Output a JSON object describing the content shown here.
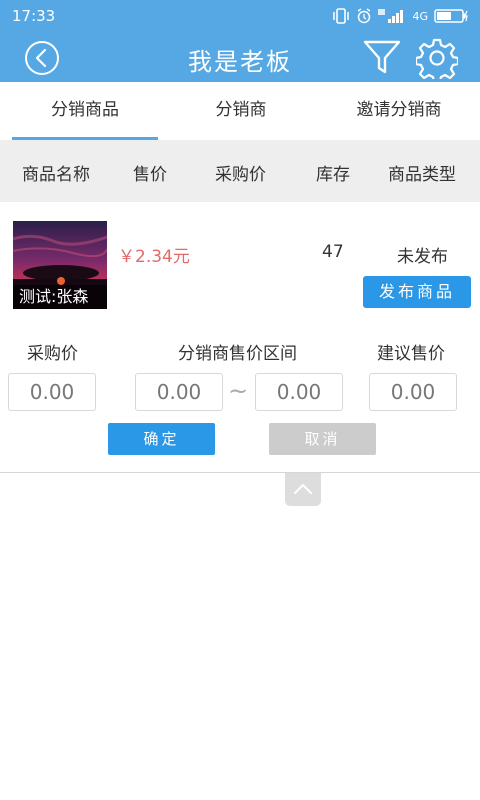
{
  "status_bar": {
    "time": "17:33",
    "network": "4G",
    "icons": [
      "vibrate-icon",
      "alarm-icon",
      "signal-icon",
      "battery-icon"
    ]
  },
  "app_bar": {
    "title": "我是老板",
    "icons": [
      "back-icon",
      "filter-icon",
      "settings-icon"
    ]
  },
  "tabs": [
    {
      "label": "分销商品",
      "active": true
    },
    {
      "label": "分销商",
      "active": false
    },
    {
      "label": "邀请分销商",
      "active": false
    }
  ],
  "columns": [
    "商品名称",
    "售价",
    "采购价",
    "库存",
    "商品类型"
  ],
  "product": {
    "caption": "测试:张森",
    "price": "￥2.34元",
    "stock": "47",
    "status": "未发布",
    "publish_label": "发布商品"
  },
  "pricing_form": {
    "purchase_label": "采购价",
    "range_label": "分销商售价区间",
    "suggested_label": "建议售价",
    "purchase_value": "0.00",
    "range_min_value": "0.00",
    "range_max_value": "0.00",
    "suggested_value": "0.00",
    "range_separator": "~",
    "confirm_label": "确定",
    "cancel_label": "取消"
  },
  "colors": {
    "header": "#55a8e3",
    "accent_button": "#2a98e6",
    "price": "#e26a6a",
    "disabled_button": "#cccccc"
  }
}
